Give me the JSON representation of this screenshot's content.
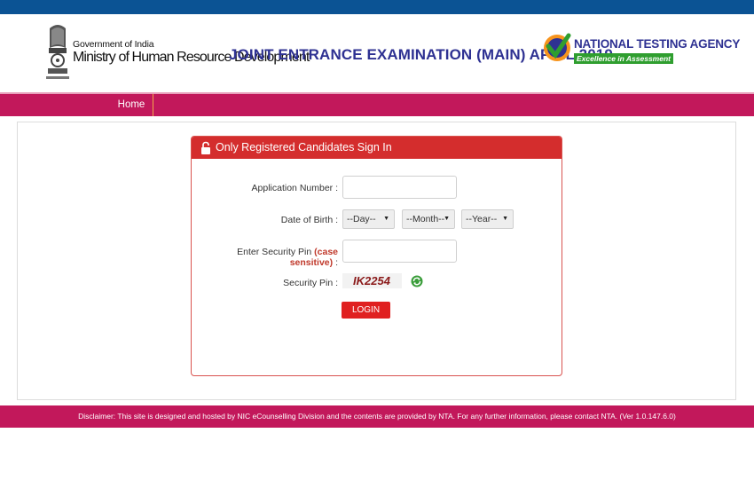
{
  "header": {
    "gov_label": "Government of India",
    "ministry_label": "Ministry of Human Resource Development",
    "exam_title": "JOINT ENTRANCE EXAMINATION (MAIN) APRIL 2019",
    "agency_name": "NATIONAL TESTING AGENCY",
    "agency_tagline": "Excellence in Assessment"
  },
  "nav": {
    "home_label": "Home"
  },
  "signin": {
    "panel_title": "Only Registered Candidates Sign In",
    "application_number_label": "Application Number :",
    "application_number_value": "",
    "dob_label": "Date of Birth :",
    "dob_day": "--Day--",
    "dob_month": "--Month--",
    "dob_year": "--Year--",
    "security_pin_label_prefix": "Enter Security Pin",
    "security_pin_case_note": "(case sensitive)",
    "security_pin_label_suffix": ":",
    "security_pin_value": "",
    "captcha_label": "Security Pin :",
    "captcha_text": "IK2254",
    "login_label": "LOGIN"
  },
  "footer": {
    "disclaimer": "Disclaimer: This site is designed and hosted by NIC eCounselling Division and the contents are provided by NTA. For any further information, please contact NTA. (Ver 1.0.147.6.0)"
  },
  "colors": {
    "top_stripe": "#0b5394",
    "nav_bar": "#c2185b",
    "panel_header": "#d42d2d",
    "exam_title": "#2e3192",
    "login_button": "#e02020"
  }
}
